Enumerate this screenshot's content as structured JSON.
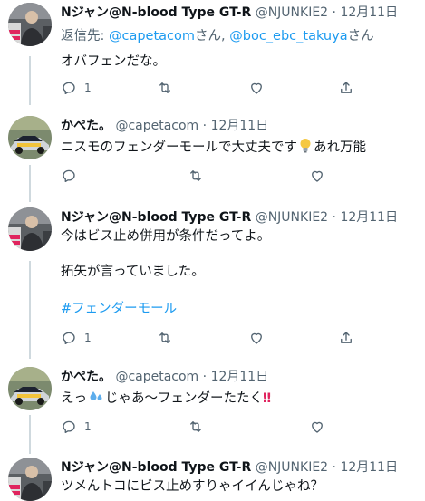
{
  "tweets": [
    {
      "name": "Nジャン@N-blood Type GT-R",
      "handle": "@NJUNKIE2",
      "dot": "·",
      "date": "12月11日",
      "reply_prefix": "返信先: ",
      "reply_user1": "@capetacom",
      "reply_sep": "さん, ",
      "reply_user2": "@boc_ebc_takuya",
      "reply_suffix": "さん",
      "text": "オバフェンだな。",
      "reply_count": "1"
    },
    {
      "name": "かぺた。",
      "handle": "@capetacom",
      "dot": "·",
      "date": "12月11日",
      "text": "ニスモのフェンダーモールで大丈夫です",
      "text_after_icon": "あれ万能"
    },
    {
      "name": "Nジャン@N-blood Type GT-R",
      "handle": "@NJUNKIE2",
      "dot": "·",
      "date": "12月11日",
      "line1": "今はビス止め併用が条件だってよ。",
      "line2": "拓矢が言っていました。",
      "hashtag": "#フェンダーモール",
      "reply_count": "1"
    },
    {
      "name": "かぺた。",
      "handle": "@capetacom",
      "dot": "·",
      "date": "12月11日",
      "text_before_icon": "えっ",
      "text_after_icon": "じゃあ～フェンダーたたく",
      "text_end": "‼",
      "reply_count": "1"
    },
    {
      "name": "Nジャン@N-blood Type GT-R",
      "handle": "@NJUNKIE2",
      "dot": "·",
      "date": "12月11日",
      "text": "ツメんトコにビス止めすりゃイイんじゃね？"
    }
  ],
  "icons": {
    "reply": "reply-icon",
    "retweet": "retweet-icon",
    "like": "heart-icon",
    "share": "share-icon",
    "bulb": "light-bulb-emoji",
    "sweat": "sweat-droplets-emoji"
  },
  "colors": {
    "link": "#1d9bf0",
    "secondary": "#536471",
    "text": "#0f1419",
    "thread_line": "#cfd9de",
    "exclaim": "#e0245e"
  }
}
